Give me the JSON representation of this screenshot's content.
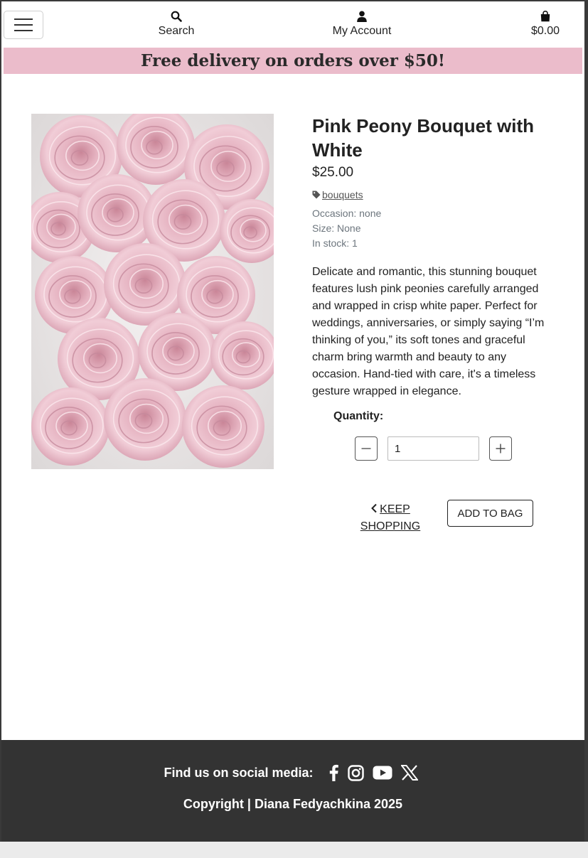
{
  "header": {
    "search_label": "Search",
    "account_label": "My Account",
    "bag_total": "$0.00"
  },
  "promo": {
    "text": "Free delivery on orders over $50!"
  },
  "product": {
    "title": "Pink Peony Bouquet with White",
    "price": "$25.00",
    "category": "bouquets",
    "occasion": "Occasion: none",
    "size": "Size: None",
    "stock": "In stock: 1",
    "description": "Delicate and romantic, this stunning bouquet features lush pink peonies carefully arranged and wrapped in crisp white paper. Perfect for weddings, anniversaries, or simply saying “I’m thinking of you,” its soft tones and graceful charm bring warmth and beauty to any occasion. Hand-tied with care, it's a timeless gesture wrapped in elegance."
  },
  "quantity": {
    "label": "Quantity:",
    "value": "1"
  },
  "actions": {
    "keep_shopping": "KEEP SHOPPING",
    "add_to_bag": "ADD TO BAG"
  },
  "footer": {
    "social_label": "Find us on social media:",
    "copyright": "Copyright | Diana Fedyachkina 2025"
  },
  "icons": {
    "menu": "hamburger-icon",
    "search": "search-icon",
    "account": "user-icon",
    "bag": "shopping-bag-icon",
    "tag": "tag-icon",
    "minus": "minus-icon",
    "plus": "plus-icon",
    "back": "chevron-left-icon",
    "social": [
      "facebook-icon",
      "instagram-icon",
      "youtube-icon",
      "x-icon"
    ]
  },
  "colors": {
    "banner": "#ebbccb",
    "footer": "#333333"
  }
}
